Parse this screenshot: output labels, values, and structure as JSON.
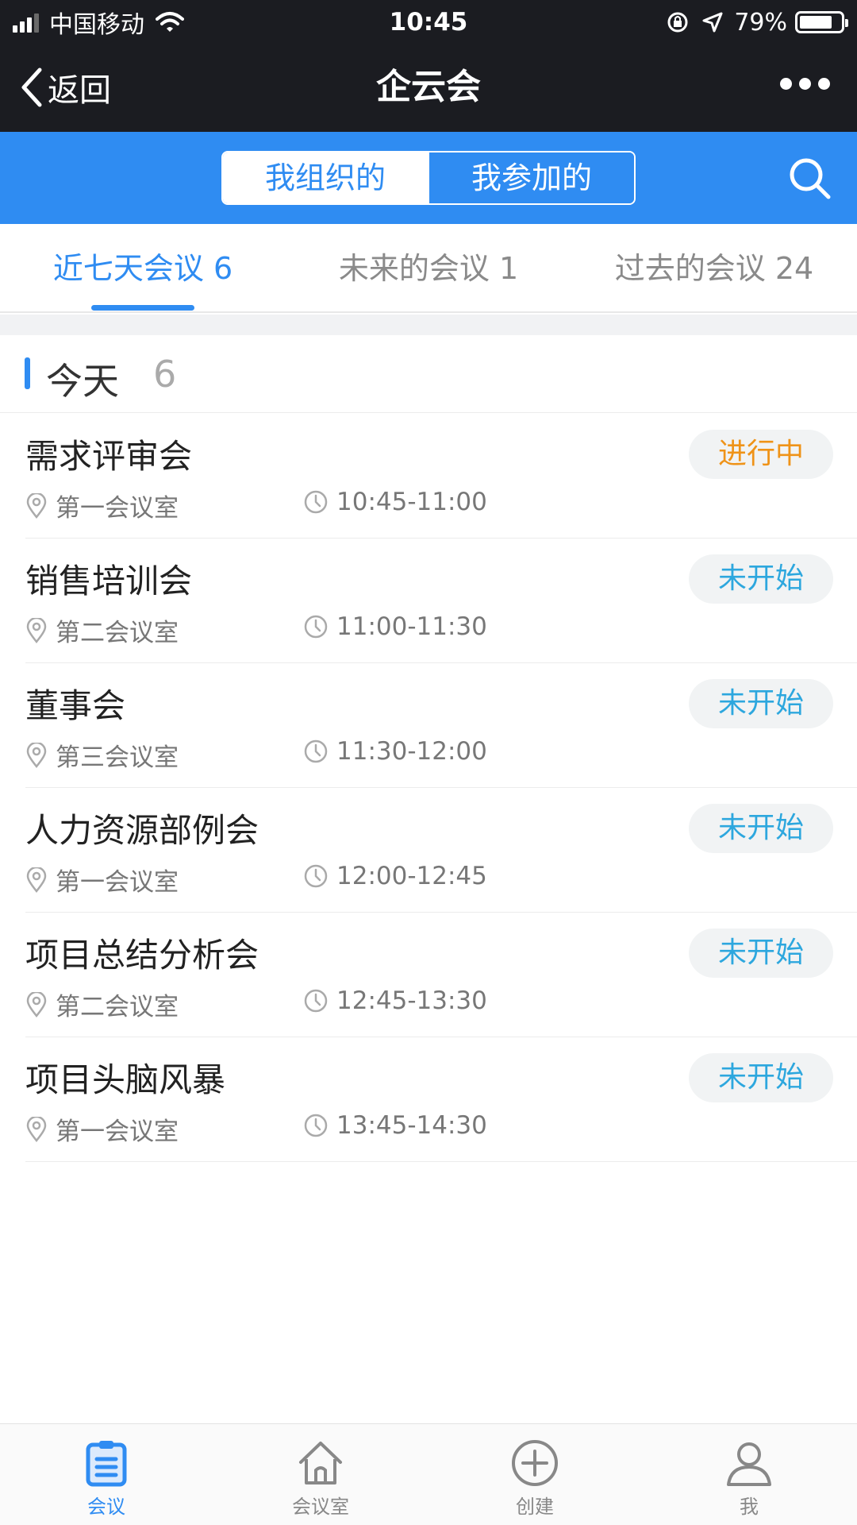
{
  "status_bar": {
    "carrier": "中国移动",
    "time": "10:45",
    "battery": "79%",
    "battery_level": 0.79
  },
  "nav": {
    "back_label": "返回",
    "title": "企云会",
    "more_icon": "more-dots-icon"
  },
  "segments": [
    {
      "label": "我组织的",
      "active": true
    },
    {
      "label": "我参加的",
      "active": false
    }
  ],
  "tabs": [
    {
      "label": "近七天会议 6",
      "active": true
    },
    {
      "label": "未来的会议 1",
      "active": false
    },
    {
      "label": "过去的会议 24",
      "active": false
    }
  ],
  "section": {
    "title": "今天",
    "count": "6"
  },
  "meetings": [
    {
      "title": "需求评审会",
      "room": "第一会议室",
      "time": "10:45-11:00",
      "status": "进行中"
    },
    {
      "title": "销售培训会",
      "room": "第二会议室",
      "time": "11:00-11:30",
      "status": "未开始"
    },
    {
      "title": "董事会",
      "room": "第三会议室",
      "time": "11:30-12:00",
      "status": "未开始"
    },
    {
      "title": "人力资源部例会",
      "room": "第一会议室",
      "time": "12:00-12:45",
      "status": "未开始"
    },
    {
      "title": "项目总结分析会",
      "room": "第二会议室",
      "time": "12:45-13:30",
      "status": "未开始"
    },
    {
      "title": "项目头脑风暴",
      "room": "第一会议室",
      "time": "13:45-14:30",
      "status": "未开始"
    }
  ],
  "tabbar": [
    {
      "label": "会议",
      "icon": "clipboard-icon",
      "active": true
    },
    {
      "label": "会议室",
      "icon": "home-icon",
      "active": false
    },
    {
      "label": "创建",
      "icon": "plus-circle-icon",
      "active": false
    },
    {
      "label": "我",
      "icon": "person-icon",
      "active": false
    }
  ],
  "colors": {
    "accent": "#2f8cf2",
    "status_running": "#ef9318",
    "status_pending": "#2da7de",
    "dark_bar": "#1b1c21"
  }
}
